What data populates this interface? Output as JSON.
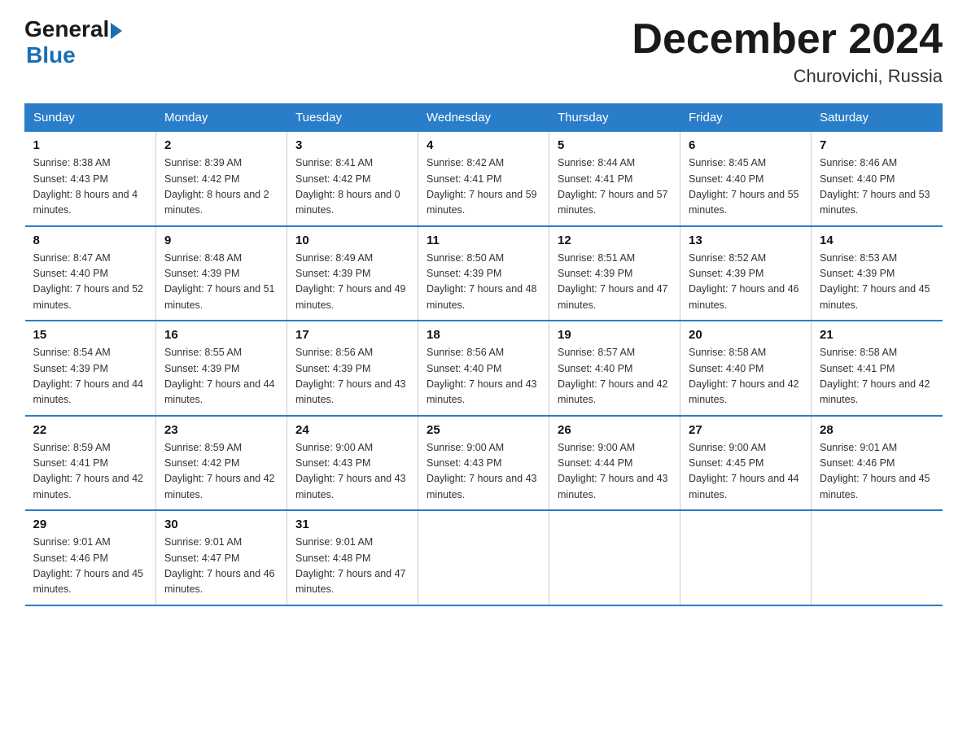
{
  "header": {
    "logo_general": "General",
    "logo_blue": "Blue",
    "month_title": "December 2024",
    "location": "Churovichi, Russia"
  },
  "days_of_week": [
    "Sunday",
    "Monday",
    "Tuesday",
    "Wednesday",
    "Thursday",
    "Friday",
    "Saturday"
  ],
  "weeks": [
    [
      {
        "day": "1",
        "sunrise": "Sunrise: 8:38 AM",
        "sunset": "Sunset: 4:43 PM",
        "daylight": "Daylight: 8 hours and 4 minutes."
      },
      {
        "day": "2",
        "sunrise": "Sunrise: 8:39 AM",
        "sunset": "Sunset: 4:42 PM",
        "daylight": "Daylight: 8 hours and 2 minutes."
      },
      {
        "day": "3",
        "sunrise": "Sunrise: 8:41 AM",
        "sunset": "Sunset: 4:42 PM",
        "daylight": "Daylight: 8 hours and 0 minutes."
      },
      {
        "day": "4",
        "sunrise": "Sunrise: 8:42 AM",
        "sunset": "Sunset: 4:41 PM",
        "daylight": "Daylight: 7 hours and 59 minutes."
      },
      {
        "day": "5",
        "sunrise": "Sunrise: 8:44 AM",
        "sunset": "Sunset: 4:41 PM",
        "daylight": "Daylight: 7 hours and 57 minutes."
      },
      {
        "day": "6",
        "sunrise": "Sunrise: 8:45 AM",
        "sunset": "Sunset: 4:40 PM",
        "daylight": "Daylight: 7 hours and 55 minutes."
      },
      {
        "day": "7",
        "sunrise": "Sunrise: 8:46 AM",
        "sunset": "Sunset: 4:40 PM",
        "daylight": "Daylight: 7 hours and 53 minutes."
      }
    ],
    [
      {
        "day": "8",
        "sunrise": "Sunrise: 8:47 AM",
        "sunset": "Sunset: 4:40 PM",
        "daylight": "Daylight: 7 hours and 52 minutes."
      },
      {
        "day": "9",
        "sunrise": "Sunrise: 8:48 AM",
        "sunset": "Sunset: 4:39 PM",
        "daylight": "Daylight: 7 hours and 51 minutes."
      },
      {
        "day": "10",
        "sunrise": "Sunrise: 8:49 AM",
        "sunset": "Sunset: 4:39 PM",
        "daylight": "Daylight: 7 hours and 49 minutes."
      },
      {
        "day": "11",
        "sunrise": "Sunrise: 8:50 AM",
        "sunset": "Sunset: 4:39 PM",
        "daylight": "Daylight: 7 hours and 48 minutes."
      },
      {
        "day": "12",
        "sunrise": "Sunrise: 8:51 AM",
        "sunset": "Sunset: 4:39 PM",
        "daylight": "Daylight: 7 hours and 47 minutes."
      },
      {
        "day": "13",
        "sunrise": "Sunrise: 8:52 AM",
        "sunset": "Sunset: 4:39 PM",
        "daylight": "Daylight: 7 hours and 46 minutes."
      },
      {
        "day": "14",
        "sunrise": "Sunrise: 8:53 AM",
        "sunset": "Sunset: 4:39 PM",
        "daylight": "Daylight: 7 hours and 45 minutes."
      }
    ],
    [
      {
        "day": "15",
        "sunrise": "Sunrise: 8:54 AM",
        "sunset": "Sunset: 4:39 PM",
        "daylight": "Daylight: 7 hours and 44 minutes."
      },
      {
        "day": "16",
        "sunrise": "Sunrise: 8:55 AM",
        "sunset": "Sunset: 4:39 PM",
        "daylight": "Daylight: 7 hours and 44 minutes."
      },
      {
        "day": "17",
        "sunrise": "Sunrise: 8:56 AM",
        "sunset": "Sunset: 4:39 PM",
        "daylight": "Daylight: 7 hours and 43 minutes."
      },
      {
        "day": "18",
        "sunrise": "Sunrise: 8:56 AM",
        "sunset": "Sunset: 4:40 PM",
        "daylight": "Daylight: 7 hours and 43 minutes."
      },
      {
        "day": "19",
        "sunrise": "Sunrise: 8:57 AM",
        "sunset": "Sunset: 4:40 PM",
        "daylight": "Daylight: 7 hours and 42 minutes."
      },
      {
        "day": "20",
        "sunrise": "Sunrise: 8:58 AM",
        "sunset": "Sunset: 4:40 PM",
        "daylight": "Daylight: 7 hours and 42 minutes."
      },
      {
        "day": "21",
        "sunrise": "Sunrise: 8:58 AM",
        "sunset": "Sunset: 4:41 PM",
        "daylight": "Daylight: 7 hours and 42 minutes."
      }
    ],
    [
      {
        "day": "22",
        "sunrise": "Sunrise: 8:59 AM",
        "sunset": "Sunset: 4:41 PM",
        "daylight": "Daylight: 7 hours and 42 minutes."
      },
      {
        "day": "23",
        "sunrise": "Sunrise: 8:59 AM",
        "sunset": "Sunset: 4:42 PM",
        "daylight": "Daylight: 7 hours and 42 minutes."
      },
      {
        "day": "24",
        "sunrise": "Sunrise: 9:00 AM",
        "sunset": "Sunset: 4:43 PM",
        "daylight": "Daylight: 7 hours and 43 minutes."
      },
      {
        "day": "25",
        "sunrise": "Sunrise: 9:00 AM",
        "sunset": "Sunset: 4:43 PM",
        "daylight": "Daylight: 7 hours and 43 minutes."
      },
      {
        "day": "26",
        "sunrise": "Sunrise: 9:00 AM",
        "sunset": "Sunset: 4:44 PM",
        "daylight": "Daylight: 7 hours and 43 minutes."
      },
      {
        "day": "27",
        "sunrise": "Sunrise: 9:00 AM",
        "sunset": "Sunset: 4:45 PM",
        "daylight": "Daylight: 7 hours and 44 minutes."
      },
      {
        "day": "28",
        "sunrise": "Sunrise: 9:01 AM",
        "sunset": "Sunset: 4:46 PM",
        "daylight": "Daylight: 7 hours and 45 minutes."
      }
    ],
    [
      {
        "day": "29",
        "sunrise": "Sunrise: 9:01 AM",
        "sunset": "Sunset: 4:46 PM",
        "daylight": "Daylight: 7 hours and 45 minutes."
      },
      {
        "day": "30",
        "sunrise": "Sunrise: 9:01 AM",
        "sunset": "Sunset: 4:47 PM",
        "daylight": "Daylight: 7 hours and 46 minutes."
      },
      {
        "day": "31",
        "sunrise": "Sunrise: 9:01 AM",
        "sunset": "Sunset: 4:48 PM",
        "daylight": "Daylight: 7 hours and 47 minutes."
      },
      null,
      null,
      null,
      null
    ]
  ]
}
